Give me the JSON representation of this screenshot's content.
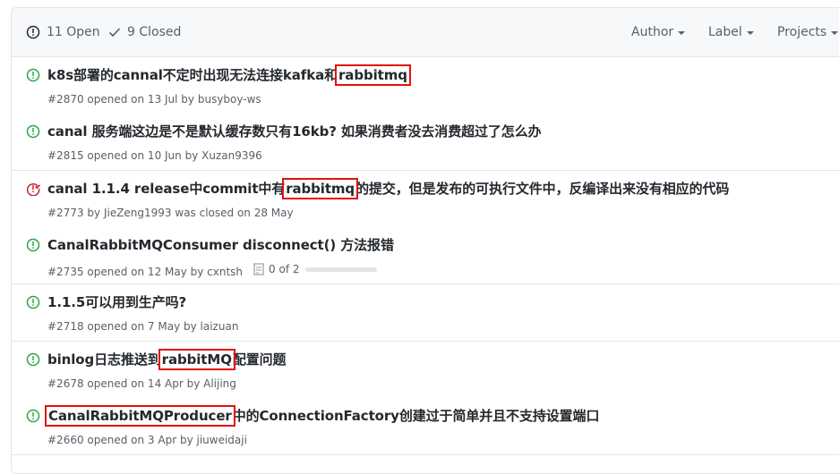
{
  "colors": {
    "open": "#28a745",
    "closed": "#cb2431",
    "highlight": "#e3120b"
  },
  "header": {
    "open_label": "11 Open",
    "closed_label": "9 Closed",
    "filters": [
      "Author",
      "Label",
      "Projects"
    ]
  },
  "issues": [
    {
      "state": "open",
      "title_pre": "k8s部署的cannal不定时出现无法连接kafka和",
      "title_hl": "rabbitmq",
      "title_post": "",
      "meta": "#2870 opened on 13 Jul by busyboy-ws",
      "progress": ""
    },
    {
      "state": "open",
      "title_pre": "canal 服务端这边是不是默认缓存数只有16kb? 如果消费者没去消费超过了怎么办",
      "title_hl": "",
      "title_post": "",
      "meta": "#2815 opened on 10 Jun by Xuzan9396",
      "progress": ""
    },
    {
      "state": "closed",
      "title_pre": "canal 1.1.4 release中commit中有",
      "title_hl": "rabbitmq",
      "title_post": "的提交，但是发布的可执行文件中，反编译出来没有相应的代码",
      "meta": "#2773 by JieZeng1993 was closed on 28 May",
      "progress": ""
    },
    {
      "state": "open",
      "title_pre": "CanalRabbitMQConsumer disconnect() 方法报错",
      "title_hl": "",
      "title_post": "",
      "meta": "#2735 opened on 12 May by cxntsh",
      "progress": "0 of 2"
    },
    {
      "state": "open",
      "title_pre": "1.1.5可以用到生产吗?",
      "title_hl": "",
      "title_post": "",
      "meta": "#2718 opened on 7 May by laizuan",
      "progress": ""
    },
    {
      "state": "open",
      "title_pre": "binlog日志推送到",
      "title_hl": "rabbitMQ",
      "title_post": "配置问题",
      "meta": "#2678 opened on 14 Apr by Alijing",
      "progress": ""
    },
    {
      "state": "open",
      "title_pre": "",
      "title_hl": "CanalRabbitMQProducer",
      "title_post": "中的ConnectionFactory创建过于简单并且不支持设置端口",
      "meta": "#2660 opened on 3 Apr by jiuweidaji",
      "progress": ""
    }
  ]
}
